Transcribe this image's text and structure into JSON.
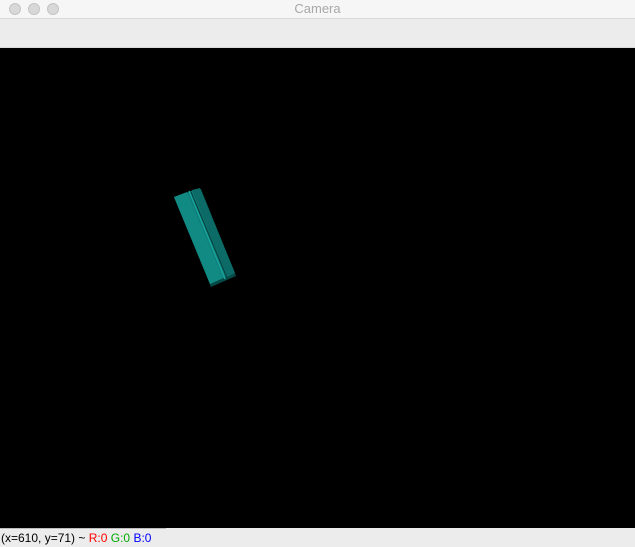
{
  "window": {
    "title": "Camera"
  },
  "status": {
    "coords": "(x=610, y=71) ~",
    "r_label": "R:0",
    "g_label": "G:0",
    "b_label": "B:0"
  },
  "colors": {
    "object_main": "#0f7b76",
    "object_edge": "#17a39c",
    "object_shadow": "#064a47",
    "red": "#ff0000",
    "green": "#00aa00",
    "blue": "#0000ff"
  },
  "icons": {
    "close": "close-icon",
    "minimize": "minimize-icon",
    "zoom": "zoom-icon"
  }
}
